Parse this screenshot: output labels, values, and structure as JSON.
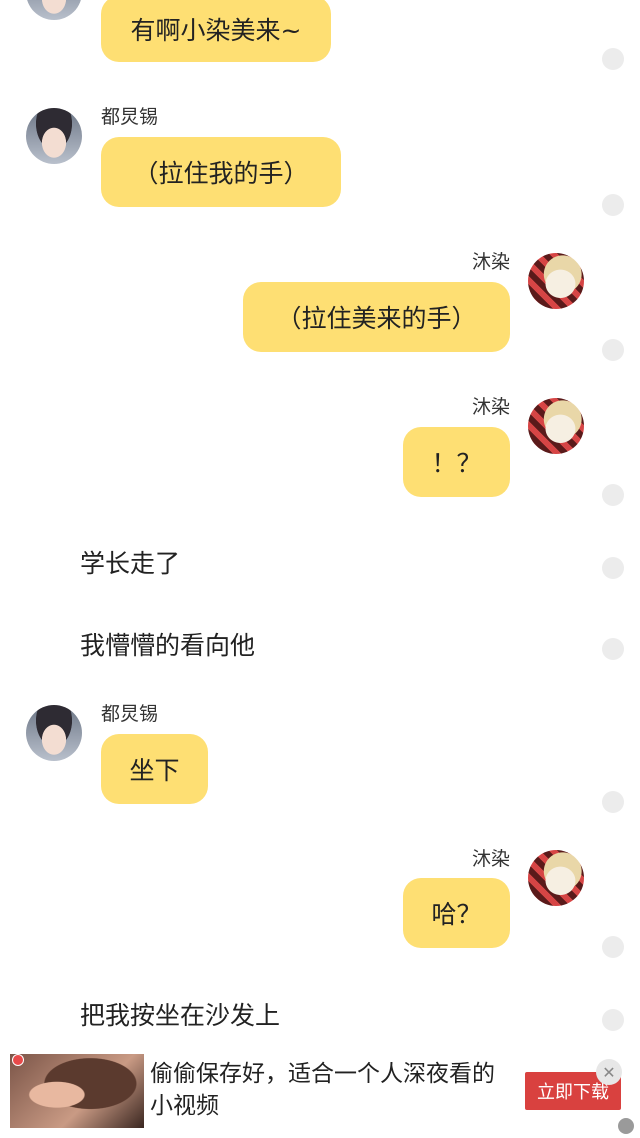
{
  "messages": [
    {
      "type": "left_partial",
      "text": "有啊小染美来~"
    },
    {
      "type": "left",
      "name": "都炅锡",
      "text": "（拉住我的手）"
    },
    {
      "type": "right",
      "name": "沐染",
      "text": "（拉住美来的手）"
    },
    {
      "type": "right",
      "name": "沐染",
      "text": "！？"
    },
    {
      "type": "narration",
      "text": "学长走了"
    },
    {
      "type": "narration",
      "text": "我懵懵的看向他"
    },
    {
      "type": "left",
      "name": "都炅锡",
      "text": "坐下"
    },
    {
      "type": "right",
      "name": "沐染",
      "text": "哈？"
    },
    {
      "type": "narration",
      "text": "把我按坐在沙发上"
    }
  ],
  "ad": {
    "title": "偷偷保存好，适合一个人深夜看的小视频",
    "button": "立即下载",
    "close": "✕"
  },
  "colors": {
    "bubble": "#fedf73",
    "ad_button": "#d9413f"
  }
}
